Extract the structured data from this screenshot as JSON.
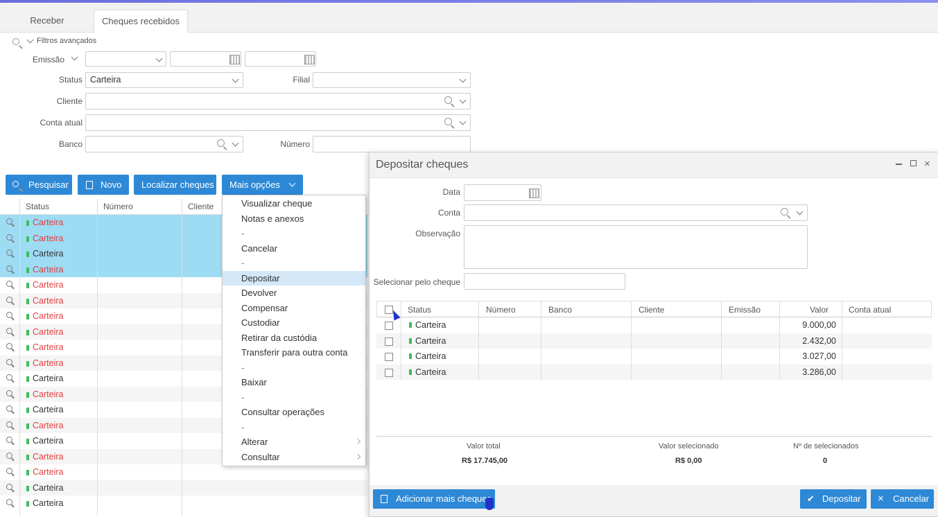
{
  "tabs": [
    {
      "label": "Receber"
    },
    {
      "label": "Cheques recebidos"
    }
  ],
  "filters": {
    "title": "Filtros avançados",
    "emissao_label": "Emissão",
    "status_label": "Status",
    "status_value": "Carteira",
    "filial_label": "Filial",
    "cliente_label": "Cliente",
    "conta_label": "Conta atual",
    "banco_label": "Banco",
    "numero_label": "Número"
  },
  "toolbar": {
    "pesquisar": "Pesquisar",
    "novo": "Novo",
    "localizar": "Localizar cheques",
    "mais_opcoes": "Mais opções"
  },
  "grid": {
    "headers": {
      "status": "Status",
      "numero": "Número",
      "cliente": "Cliente"
    },
    "rows": [
      {
        "status": "Carteira",
        "color": "#e53c3c",
        "selected": true
      },
      {
        "status": "Carteira",
        "color": "#e53c3c",
        "selected": true
      },
      {
        "status": "Carteira",
        "color": "#333333",
        "selected": true
      },
      {
        "status": "Carteira",
        "color": "#e53c3c",
        "selected": true
      },
      {
        "status": "Carteira",
        "color": "#e53c3c",
        "selected": false
      },
      {
        "status": "Carteira",
        "color": "#e53c3c",
        "selected": false
      },
      {
        "status": "Carteira",
        "color": "#e53c3c",
        "selected": false
      },
      {
        "status": "Carteira",
        "color": "#e53c3c",
        "selected": false
      },
      {
        "status": "Carteira",
        "color": "#e53c3c",
        "selected": false
      },
      {
        "status": "Carteira",
        "color": "#e53c3c",
        "selected": false
      },
      {
        "status": "Carteira",
        "color": "#333333",
        "selected": false
      },
      {
        "status": "Carteira",
        "color": "#e53c3c",
        "selected": false
      },
      {
        "status": "Carteira",
        "color": "#333333",
        "selected": false
      },
      {
        "status": "Carteira",
        "color": "#e53c3c",
        "selected": false
      },
      {
        "status": "Carteira",
        "color": "#333333",
        "selected": false
      },
      {
        "status": "Carteira",
        "color": "#e53c3c",
        "selected": false
      },
      {
        "status": "Carteira",
        "color": "#e53c3c",
        "selected": false
      },
      {
        "status": "Carteira",
        "color": "#333333",
        "selected": false
      },
      {
        "status": "Carteira",
        "color": "#333333",
        "selected": false
      }
    ]
  },
  "menu": {
    "items": [
      {
        "label": "Visualizar cheque"
      },
      {
        "label": "Notas e anexos"
      },
      {
        "label": "-"
      },
      {
        "label": "Cancelar"
      },
      {
        "label": "-"
      },
      {
        "label": "Depositar",
        "highlighted": true
      },
      {
        "label": "Devolver"
      },
      {
        "label": "Compensar"
      },
      {
        "label": "Custodiar"
      },
      {
        "label": "Retirar da custódia"
      },
      {
        "label": "Transferir para outra conta"
      },
      {
        "label": "-"
      },
      {
        "label": "Baixar"
      },
      {
        "label": "-"
      },
      {
        "label": "Consultar operações"
      },
      {
        "label": "-"
      },
      {
        "label": "Alterar",
        "submenu": true
      },
      {
        "label": "Consultar",
        "submenu": true
      }
    ]
  },
  "dialog": {
    "title": "Depositar cheques",
    "data_label": "Data",
    "conta_label": "Conta",
    "obs_label": "Observação",
    "selecionar_label": "Selecionar pelo cheque",
    "headers": {
      "status": "Status",
      "numero": "Número",
      "banco": "Banco",
      "cliente": "Cliente",
      "emissao": "Emissão",
      "valor": "Valor",
      "conta": "Conta atual"
    },
    "rows": [
      {
        "status": "Carteira",
        "valor": "9.000,00"
      },
      {
        "status": "Carteira",
        "valor": "2.432,00"
      },
      {
        "status": "Carteira",
        "valor": "3.027,00"
      },
      {
        "status": "Carteira",
        "valor": "3.286,00"
      }
    ],
    "summary": {
      "total_label": "Valor total",
      "total_value": "R$ 17.745,00",
      "sel_label": "Valor selecionado",
      "sel_value": "R$ 0,00",
      "count_label": "Nº de selecionados",
      "count_value": "0"
    },
    "adicionar": "Adicionar mais cheques",
    "depositar": "Depositar",
    "cancelar": "Cancelar"
  }
}
